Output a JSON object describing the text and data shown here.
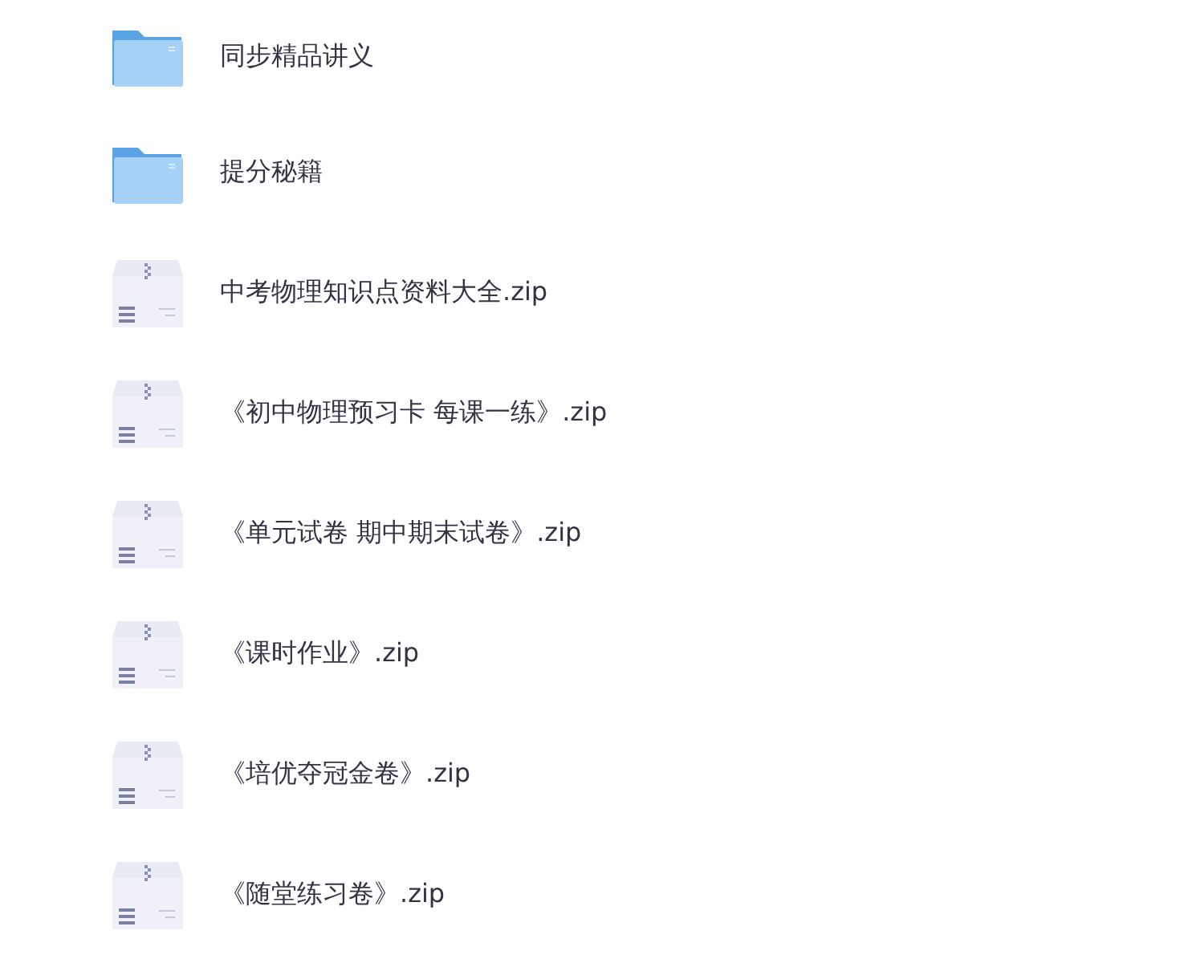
{
  "files": [
    {
      "kind": "folder",
      "name": "同步精品讲义"
    },
    {
      "kind": "folder",
      "name": "提分秘籍"
    },
    {
      "kind": "archive",
      "name": "中考物理知识点资料大全.zip"
    },
    {
      "kind": "archive",
      "name": "《初中物理预习卡 每课一练》.zip"
    },
    {
      "kind": "archive",
      "name": "《单元试卷 期中期末试卷》.zip"
    },
    {
      "kind": "archive",
      "name": "《课时作业》.zip"
    },
    {
      "kind": "archive",
      "name": "《培优夺冠金卷》.zip"
    },
    {
      "kind": "archive",
      "name": "《随堂练习卷》.zip"
    }
  ]
}
